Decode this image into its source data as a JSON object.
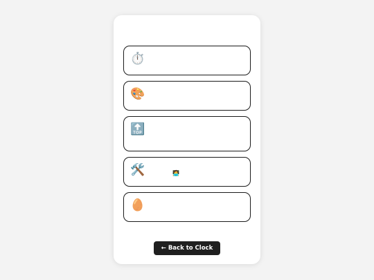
{
  "cards": [
    {
      "icon": "⏱️",
      "icon_name": "stopwatch-icon"
    },
    {
      "icon": "🎨",
      "icon_name": "palette-icon"
    },
    {
      "icon": "🔝",
      "icon_name": "top-arrow-icon"
    },
    {
      "icon": "🛠️",
      "icon_name": "tools-icon",
      "extra_icon": "🧑‍💻",
      "extra_icon_name": "technologist-icon"
    },
    {
      "icon": "🥚",
      "icon_name": "egg-icon"
    }
  ],
  "back_button": {
    "label": "← Back to Clock"
  }
}
